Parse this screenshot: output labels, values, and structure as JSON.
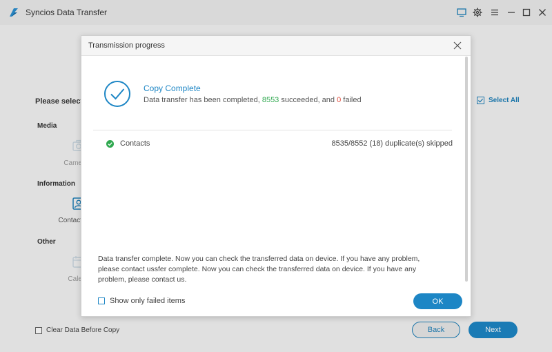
{
  "window": {
    "title": "Syncios Data Transfer",
    "icons": [
      "screen-icon",
      "gear-icon",
      "menu-icon",
      "minimize-icon",
      "maximize-icon",
      "close-icon"
    ]
  },
  "background": {
    "heading": "Please select",
    "select_all": "Select All",
    "sections": {
      "media": "Media",
      "information": "Information",
      "other": "Other"
    },
    "tiles": {
      "camera": "Came",
      "contacts": "Contact",
      "calendar": "Cale"
    },
    "clear_data_label": "Clear Data Before Copy",
    "back_label": "Back",
    "next_label": "Next"
  },
  "dialog": {
    "title": "Transmission progress",
    "status_title": "Copy Complete",
    "message_prefix": "Data transfer has been completed, ",
    "succeeded_count": "8553",
    "message_mid": " succeeded, and ",
    "failed_count": "0",
    "message_suffix": " failed",
    "results": [
      {
        "name": "Contacts",
        "stat": "8535/8552 (18) duplicate(s) skipped"
      }
    ],
    "note": "Data transfer complete. Now you can check the transferred data on device. If you have any problem, please contact ussfer complete. Now you can check the transferred data on device. If you have any problem, please contact us.",
    "show_failed_label": "Show only failed items",
    "ok_label": "OK"
  },
  "colors": {
    "accent": "#1d86c5",
    "success": "#2fa84f",
    "failure": "#e04a3a"
  }
}
